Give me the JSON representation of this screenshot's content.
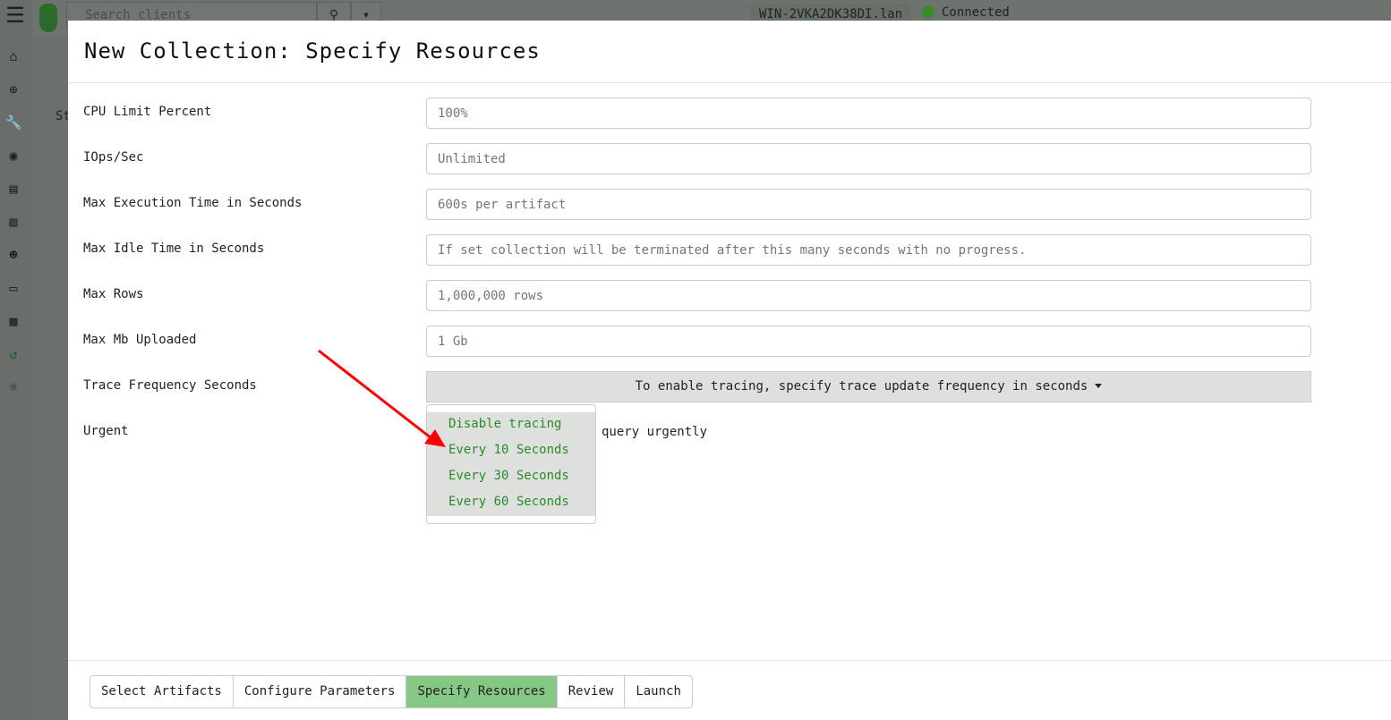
{
  "topbar": {
    "search_placeholder": "Search clients",
    "hostname": "WIN-2VKA2DK38DI.lan",
    "status": "Connected"
  },
  "background": {
    "partial_text": "St"
  },
  "modal": {
    "title": "New Collection: Specify Resources",
    "fields": [
      {
        "label": "CPU Limit Percent",
        "placeholder": "100%"
      },
      {
        "label": "IOps/Sec",
        "placeholder": "Unlimited"
      },
      {
        "label": "Max Execution Time in Seconds",
        "placeholder": "600s per artifact"
      },
      {
        "label": "Max Idle Time in Seconds",
        "placeholder": "If set collection will be terminated after this many seconds with no progress."
      },
      {
        "label": "Max Rows",
        "placeholder": "1,000,000 rows"
      },
      {
        "label": "Max Mb Uploaded",
        "placeholder": "1 Gb"
      }
    ],
    "trace": {
      "label": "Trace Frequency Seconds",
      "button": "To enable tracing, specify trace update frequency in seconds",
      "options": [
        "Disable tracing",
        "Every 10 Seconds",
        "Every 30 Seconds",
        "Every 60 Seconds"
      ]
    },
    "urgent": {
      "label": "Urgent",
      "text": "query urgently"
    },
    "steps": [
      "Select Artifacts",
      "Configure Parameters",
      "Specify Resources",
      "Review",
      "Launch"
    ],
    "active_step": "Specify Resources"
  },
  "colors": {
    "active_step": "#85c785",
    "menu_text": "#2a8a2a",
    "arrow": "#ff0000"
  }
}
